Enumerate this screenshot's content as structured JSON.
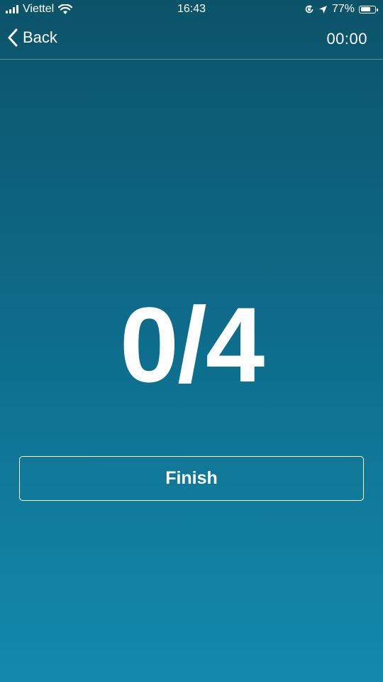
{
  "status_bar": {
    "carrier": "Viettel",
    "time": "16:43",
    "battery_percent": "77%",
    "battery_level": 0.77,
    "icons": [
      "signal-icon",
      "wifi-icon",
      "orientation-lock-icon",
      "location-icon",
      "battery-icon"
    ]
  },
  "nav": {
    "back_label": "Back",
    "timer": "00:00",
    "icons": [
      "chevron-left-icon"
    ]
  },
  "main": {
    "score": "0/4",
    "finish_label": "Finish"
  },
  "colors": {
    "gradient_top": "#0c5369",
    "gradient_bottom": "#138aad",
    "text": "#ffffff"
  }
}
